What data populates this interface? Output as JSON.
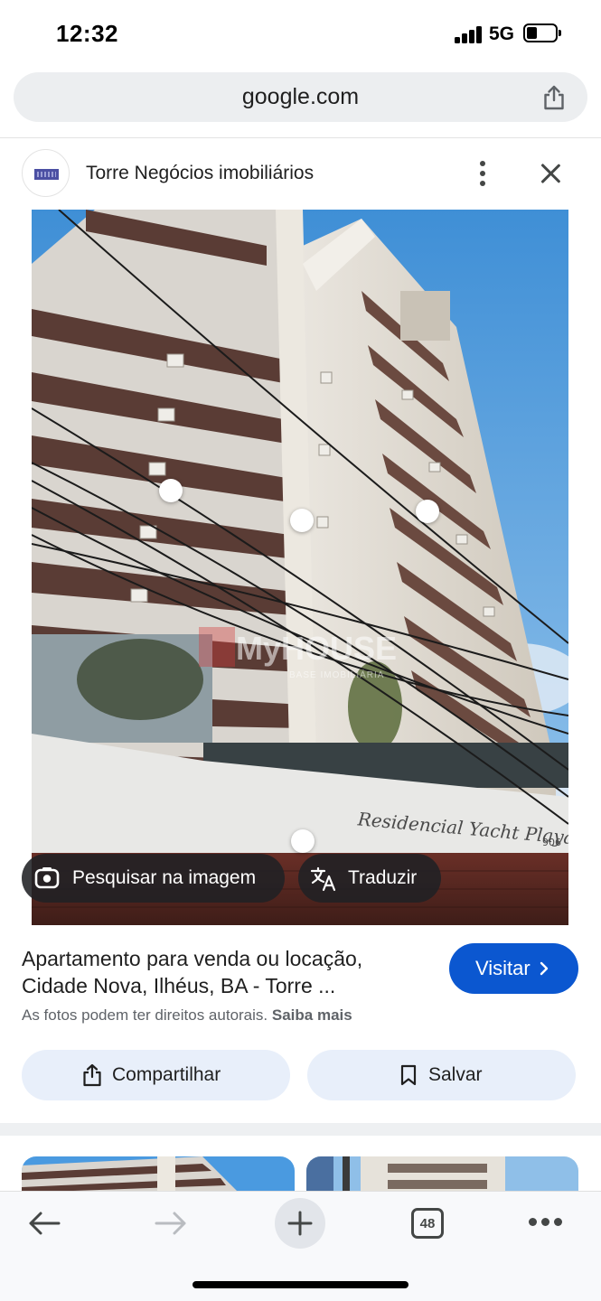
{
  "status_bar": {
    "time": "12:32",
    "network": "5G"
  },
  "browser": {
    "url": "google.com"
  },
  "source": {
    "name": "Torre Negócios imobiliários"
  },
  "image": {
    "watermark_brand": "MyHOUSE",
    "watermark_sub": "BASE IMOBILIÁRIA",
    "facade_sign": "Residencial Yacht Playa",
    "facade_number": "906"
  },
  "lens": {
    "search_label": "Pesquisar na imagem",
    "translate_label": "Traduzir"
  },
  "result": {
    "title_line1": "Apartamento para venda ou locação,",
    "title_line2": "Cidade Nova, Ilhéus, BA - Torre ...",
    "visit_label": "Visitar",
    "copyright_text": "As fotos podem ter direitos autorais.",
    "learn_more": "Saiba mais"
  },
  "actions": {
    "share_label": "Compartilhar",
    "save_label": "Salvar"
  },
  "toolbar": {
    "tab_count": "48"
  },
  "colors": {
    "accent": "#0b57d0",
    "chip_bg": "#e8effa",
    "url_bar_bg": "#eceef0"
  }
}
